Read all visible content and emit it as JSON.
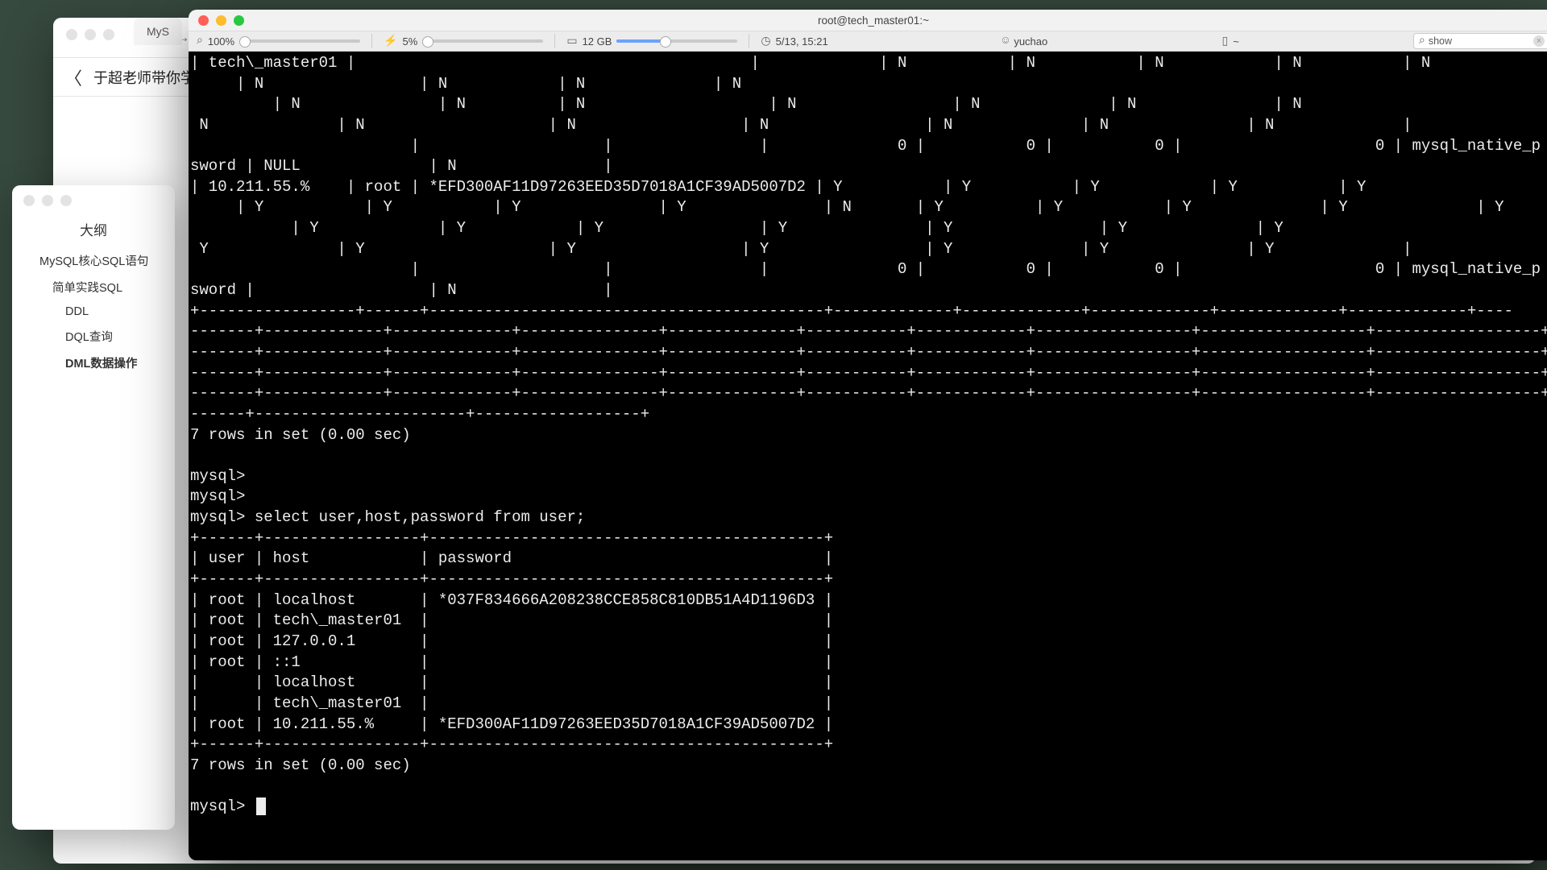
{
  "safari": {
    "tab_label": "MyS",
    "page_title": "于超老师带你学"
  },
  "outline": {
    "title": "大纲",
    "items": [
      {
        "label": "MySQL核心SQL语句",
        "level": 1,
        "active": false
      },
      {
        "label": "简单实践SQL",
        "level": 2,
        "active": false
      },
      {
        "label": "DDL",
        "level": 3,
        "active": false
      },
      {
        "label": "DQL查询",
        "level": 3,
        "active": false
      },
      {
        "label": "DML数据操作",
        "level": 3,
        "active": true
      }
    ]
  },
  "terminal": {
    "window_title": "root@tech_master01:~",
    "status": {
      "zoom": "100%",
      "cpu": "5%",
      "memory": "12 GB",
      "datetime": "5/13, 15:21",
      "user": "yuchao",
      "path": "~",
      "search_placeholder": "show"
    },
    "prompt": "mysql>",
    "query": "select user,host,password from user;",
    "rows_msg_top": "7 rows in set (0.00 sec)",
    "rows_msg_bottom": "7 rows in set (0.00 sec)",
    "table_header": {
      "c1": "user",
      "c2": "host",
      "c3": "password"
    },
    "table_rows": [
      {
        "user": "root",
        "host": "localhost",
        "password": "*037F834666A208238CCE858C810DB51A4D1196D3"
      },
      {
        "user": "root",
        "host": "tech\\_master01",
        "password": ""
      },
      {
        "user": "root",
        "host": "127.0.0.1",
        "password": ""
      },
      {
        "user": "root",
        "host": "::1",
        "password": ""
      },
      {
        "user": "",
        "host": "localhost",
        "password": ""
      },
      {
        "user": "",
        "host": "tech\\_master01",
        "password": ""
      },
      {
        "user": "root",
        "host": "10.211.55.%",
        "password": "*EFD300AF11D97263EED35D7018A1CF39AD5007D2"
      }
    ],
    "scrollback_lines": [
      "| tech\\_master01 |                                           |             | N           | N           | N            | N           | N",
      "     | N                 | N            | N              | N ",
      "         | N               | N          | N                    | N                 | N              | N               | N",
      " N              | N                    | N                  | N                 | N              | N               | N              |",
      "                        |                    |                |              0 |           0 |           0 |                     0 | mysql_native_p",
      "sword | NULL              | N                |",
      "| 10.211.55.%    | root | *EFD300AF11D97263EED35D7018A1CF39AD5007D2 | Y           | Y           | Y            | Y           | Y",
      "     | Y           | Y           | Y               | Y               | N       | Y          | Y           | Y              | Y              | Y",
      "           | Y             | Y            | Y                 | Y               | Y                | Y              | Y",
      " Y              | Y                    | Y                  | Y                 | Y              | Y               | Y              |",
      "                        |                    |                |              0 |           0 |           0 |                     0 | mysql_native_p",
      "sword |                   | N                |",
      "+-----------------+------+-------------------------------------------+-------------+-------------+-------------+-------------+-------------+----",
      "-------+-------------+-------------+---------------+--------------+-----------+------------+-----------------+------------------+------------------+-",
      "-------+-------------+-------------+---------------+--------------+-----------+------------+-----------------+------------------+------------------+-",
      "-------+-------------+-------------+---------------+--------------+-----------+------------+-----------------+------------------+------------------+-",
      "-------+-------------+-------------+---------------+--------------+-----------+------------+-----------------+------------------+------------------+-",
      "------+-----------------------+------------------+"
    ],
    "hr": "+------+-----------------+-------------------------------------------+",
    "blank": ""
  }
}
